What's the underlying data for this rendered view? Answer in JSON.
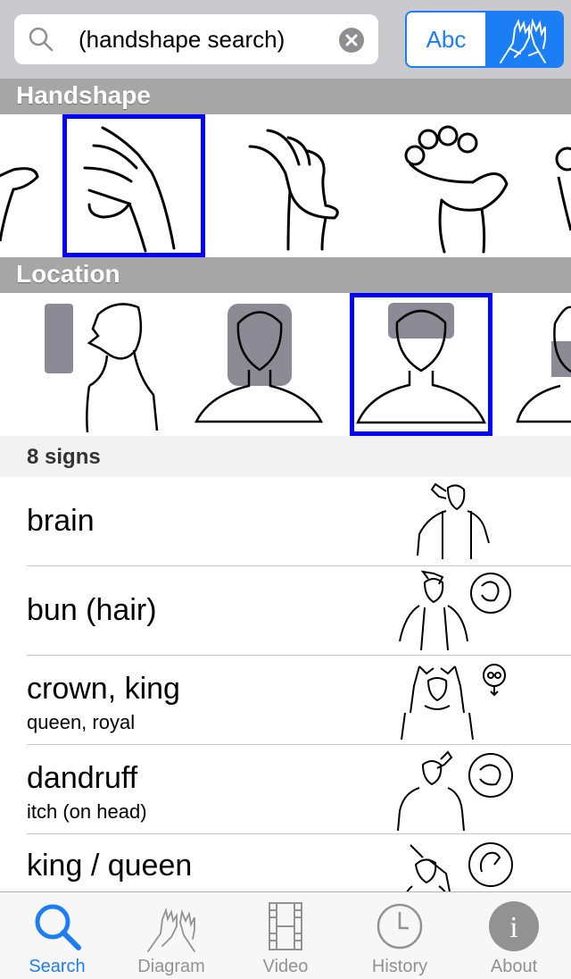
{
  "search": {
    "text": "(handshape search)"
  },
  "mode_toggle": {
    "text_label": "Abc",
    "selected": "handshape"
  },
  "sections": {
    "handshape_header": "Handshape",
    "location_header": "Location"
  },
  "results": {
    "count_label": "8 signs",
    "items": [
      {
        "title": "brain",
        "subtitle": ""
      },
      {
        "title": "bun (hair)",
        "subtitle": ""
      },
      {
        "title": "crown, king",
        "subtitle": "queen, royal"
      },
      {
        "title": "dandruff",
        "subtitle": "itch (on head)"
      },
      {
        "title": "king / queen",
        "subtitle": ""
      }
    ]
  },
  "tabs": [
    {
      "label": "Search",
      "icon": "search-icon",
      "active": true
    },
    {
      "label": "Diagram",
      "icon": "hands-icon",
      "active": false
    },
    {
      "label": "Video",
      "icon": "film-icon",
      "active": false
    },
    {
      "label": "History",
      "icon": "clock-icon",
      "active": false
    },
    {
      "label": "About",
      "icon": "info-icon",
      "active": false
    }
  ],
  "colors": {
    "accent": "#1b7ef5",
    "selection_border": "#0000ff",
    "section_header": "#a6a6a6"
  }
}
